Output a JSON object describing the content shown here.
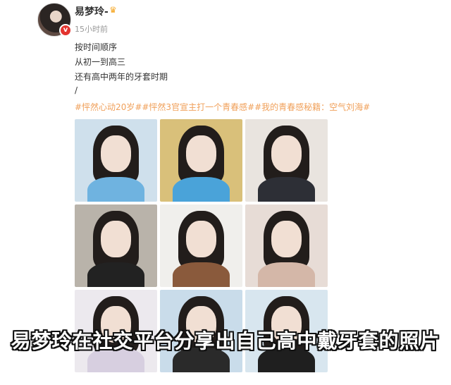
{
  "post": {
    "username": "易梦玲-",
    "time": "15小时前",
    "lines": [
      "按时间顺序",
      "从初一到高三",
      "还有高中两年的牙套时期",
      "/"
    ],
    "hashtags": "#怦然心动20岁##怦然3官宣主打一个青春感##我的青春感秘籍：空气刘海#"
  },
  "icons": {
    "crown": "crown-icon",
    "verified": "verified-badge-icon"
  },
  "photos": [
    {
      "name": "photo-1",
      "bg": "#cfe0ec",
      "body": "#6fb3e0"
    },
    {
      "name": "photo-2",
      "bg": "#d9c07a",
      "body": "#4aa3d9"
    },
    {
      "name": "photo-3",
      "bg": "#e9e4df",
      "body": "#2d2f36"
    },
    {
      "name": "photo-4",
      "bg": "#b9b3aa",
      "body": "#222222"
    },
    {
      "name": "photo-5",
      "bg": "#f0efec",
      "body": "#8a5a3c"
    },
    {
      "name": "photo-6",
      "bg": "#e7dcd6",
      "body": "#d4b7a8"
    },
    {
      "name": "photo-7",
      "bg": "#ece9ee",
      "body": "#d7cfe0"
    },
    {
      "name": "photo-8",
      "bg": "#c9dcea",
      "body": "#2a2a2a"
    },
    {
      "name": "photo-9",
      "bg": "#d8e6ef",
      "body": "#1f1f1f"
    }
  ],
  "caption": "易梦玲在社交平台分享出自己高中戴牙套的照片",
  "colors": {
    "hashtag": "#f0a05a",
    "verified": "#e3342f"
  }
}
